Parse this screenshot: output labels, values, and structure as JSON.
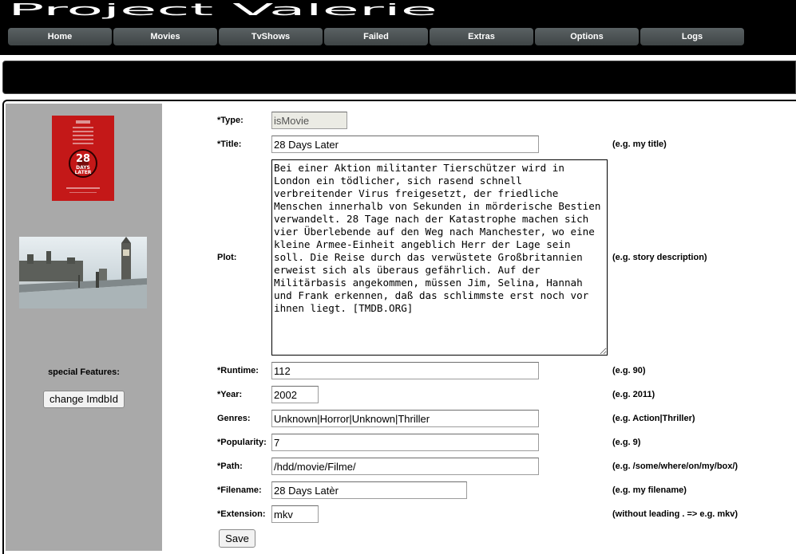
{
  "app": {
    "title": "Project Valerie"
  },
  "nav": {
    "items": [
      {
        "label": "Home"
      },
      {
        "label": "Movies"
      },
      {
        "label": "TvShows"
      },
      {
        "label": "Failed"
      },
      {
        "label": "Extras"
      },
      {
        "label": "Options"
      },
      {
        "label": "Logs"
      }
    ]
  },
  "poster": {
    "text": "28 DAYS LATER"
  },
  "sidebar": {
    "special_features_label": "special Features:",
    "change_imdb_button": "change ImdbId"
  },
  "form": {
    "type": {
      "label": "*Type:",
      "value": "isMovie"
    },
    "title": {
      "label": "*Title:",
      "value": "28 Days Later",
      "hint": "(e.g. my title)"
    },
    "plot": {
      "label": "Plot:",
      "value": "Bei einer Aktion militanter Tierschützer wird in London ein tödlicher, sich rasend schnell verbreitender Virus freigesetzt, der friedliche Menschen innerhalb von Sekunden in mörderische Bestien verwandelt. 28 Tage nach der Katastrophe machen sich vier Überlebende auf den Weg nach Manchester, wo eine kleine Armee-Einheit angeblich Herr der Lage sein soll. Die Reise durch das verwüstete Großbritannien erweist sich als überaus gefährlich. Auf der Militärbasis angekommen, müssen Jim, Selina, Hannah und Frank erkennen, daß das schlimmste erst noch vor ihnen liegt. [TMDB.ORG]",
      "hint": "(e.g. story description)"
    },
    "runtime": {
      "label": "*Runtime:",
      "value": "112",
      "hint": "(e.g. 90)"
    },
    "year": {
      "label": "*Year:",
      "value": "2002",
      "hint": "(e.g. 2011)"
    },
    "genres": {
      "label": "Genres:",
      "value": "Unknown|Horror|Unknown|Thriller",
      "hint": "(e.g. Action|Thriller)"
    },
    "popularity": {
      "label": "*Popularity:",
      "value": "7",
      "hint": "(e.g. 9)"
    },
    "path": {
      "label": "*Path:",
      "value": "/hdd/movie/Filme/",
      "hint": "(e.g. /some/where/on/my/box/)"
    },
    "filename": {
      "label": "*Filename:",
      "value": "28 Days Latèr",
      "hint": "(e.g. my filename)"
    },
    "extension": {
      "label": "*Extension:",
      "value": "mkv",
      "hint": "(without leading . => e.g. mkv)"
    },
    "save_button": "Save"
  },
  "colors": {
    "header_bg": "#000000",
    "nav_button": "#4a5051",
    "sidebar_bg": "#a9a9a9",
    "poster_red": "#c41818"
  }
}
